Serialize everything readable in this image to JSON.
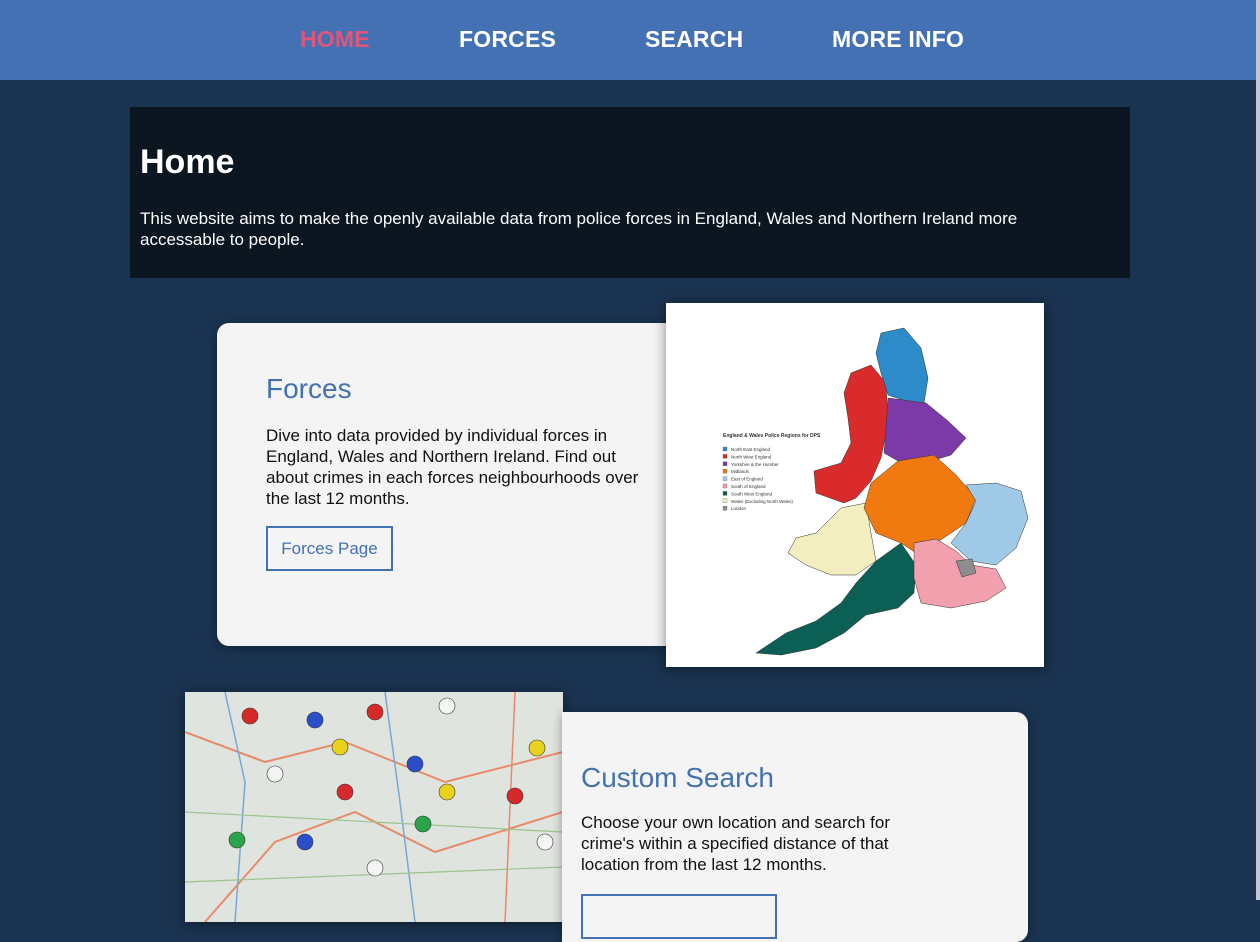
{
  "nav": {
    "items": [
      {
        "label": "HOME",
        "active": true
      },
      {
        "label": "FORCES",
        "active": false
      },
      {
        "label": "SEARCH",
        "active": false
      },
      {
        "label": "MORE INFO",
        "active": false
      }
    ]
  },
  "hero": {
    "title": "Home",
    "text": "This website aims to make the openly available data from police forces in England, Wales and Northern Ireland more accessable to people."
  },
  "forces_card": {
    "title": "Forces",
    "text": "Dive into data provided by individual forces in England, Wales and Northern Ireland. Find out about crimes in each forces neighbourhoods over the last 12 months.",
    "button_label": "Forces Page"
  },
  "map_image": {
    "legend_title": "England & Wales Police Regions for DPS",
    "legend": [
      {
        "label": "North East England",
        "color": "#2e8bc9"
      },
      {
        "label": "North West England",
        "color": "#d92b2b"
      },
      {
        "label": "Yorkshire & the Humber",
        "color": "#7b3aa8"
      },
      {
        "label": "Midlands",
        "color": "#f07a10"
      },
      {
        "label": "East of England",
        "color": "#9fc9e6"
      },
      {
        "label": "South of England",
        "color": "#f2a0ad"
      },
      {
        "label": "South West England",
        "color": "#0b5f55"
      },
      {
        "label": "Wales (Excluding North Wales)",
        "color": "#f3eec0"
      },
      {
        "label": "London",
        "color": "#8d8d8d"
      }
    ]
  },
  "search_card": {
    "title": "Custom Search",
    "text": "Choose your own location and search for crime's within a specified distance of that location from the last 12 months.",
    "button_label": ""
  },
  "colors": {
    "nav_bg": "#4371b3",
    "nav_active": "#e0567a",
    "page_bg": "#1a3350",
    "hero_bg": "#0c1621",
    "card_bg": "#f4f4f4",
    "accent": "#4371b3"
  }
}
